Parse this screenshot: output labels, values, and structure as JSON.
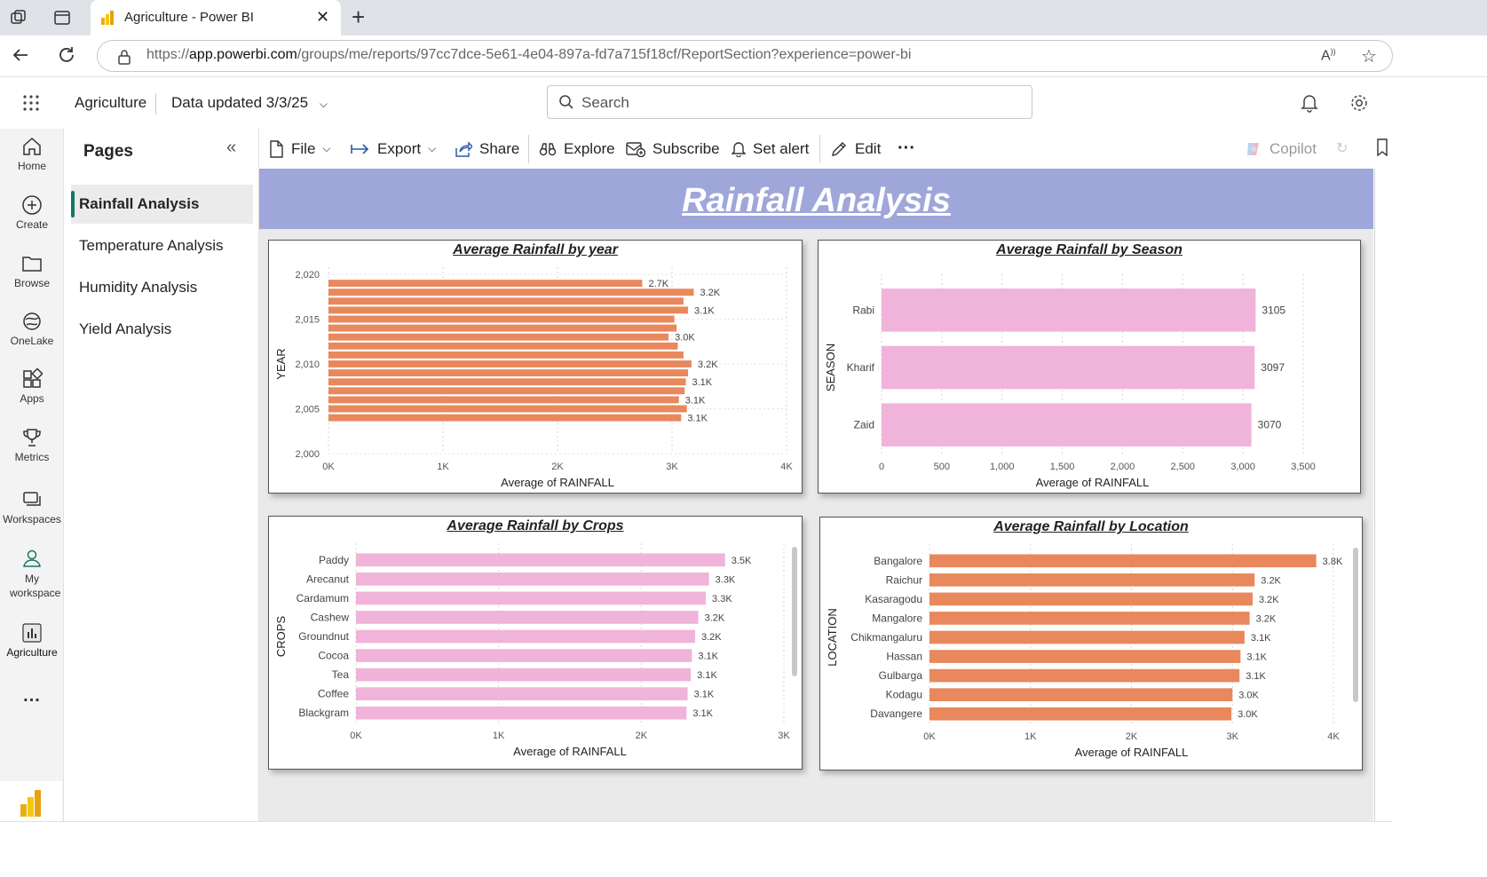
{
  "browser": {
    "tab_title": "Agriculture - Power BI",
    "url_prefix": "https://",
    "url_host": "app.powerbi.com",
    "url_path": "/groups/me/reports/97cc7dce-5e61-4e04-897a-fd7a715f18cf/ReportSection?experience=power-bi"
  },
  "header": {
    "workspace": "Agriculture",
    "data_updated": "Data updated 3/3/25",
    "search_placeholder": "Search"
  },
  "leftnav": {
    "items": [
      {
        "label": "Home",
        "icon": "home-icon"
      },
      {
        "label": "Create",
        "icon": "plus-circle-icon"
      },
      {
        "label": "Browse",
        "icon": "folder-icon"
      },
      {
        "label": "OneLake",
        "icon": "onelake-icon"
      },
      {
        "label": "Apps",
        "icon": "apps-icon"
      },
      {
        "label": "Metrics",
        "icon": "trophy-icon"
      },
      {
        "label": "Workspaces",
        "icon": "workspaces-icon"
      },
      {
        "label": "My workspace",
        "icon": "person-icon"
      },
      {
        "label": "Agriculture",
        "icon": "report-icon"
      }
    ],
    "more": "..."
  },
  "pages_pane": {
    "title": "Pages",
    "items": [
      "Rainfall Analysis",
      "Temperature Analysis",
      "Humidity Analysis",
      "Yield Analysis"
    ],
    "active": "Rainfall Analysis"
  },
  "toolbar": {
    "file": "File",
    "export": "Export",
    "share": "Share",
    "explore": "Explore",
    "subscribe": "Subscribe",
    "set_alert": "Set alert",
    "edit": "Edit",
    "more": "···",
    "copilot": "Copilot"
  },
  "report": {
    "banner_title": "Rainfall Analysis"
  },
  "colors": {
    "orange_bar": "#e8885c",
    "pink_bar": "#f0b3d9",
    "banner": "#9fa6d9",
    "accent": "#117865"
  },
  "chart_data": [
    {
      "id": "by_year",
      "type": "bar",
      "orientation": "horizontal",
      "title": "Average Rainfall by year",
      "xlabel": "Average of RAINFALL",
      "ylabel": "YEAR",
      "xlim": [
        0,
        4000
      ],
      "ylim": [
        2000,
        2020
      ],
      "x_ticks": [
        "0K",
        "1K",
        "2K",
        "3K",
        "4K"
      ],
      "y_ticks": [
        "2,000",
        "2,005",
        "2,010",
        "2,015",
        "2,020"
      ],
      "years": [
        2019,
        2018,
        2017,
        2016,
        2015,
        2014,
        2013,
        2012,
        2011,
        2010,
        2009,
        2008,
        2007,
        2006,
        2005,
        2004
      ],
      "values": [
        2740,
        3190,
        3100,
        3140,
        3020,
        3040,
        2970,
        3050,
        3100,
        3170,
        3140,
        3120,
        3110,
        3060,
        3130,
        3080
      ],
      "labels": [
        "2.7K",
        "3.2K",
        "",
        "3.1K",
        "",
        "",
        "3.0K",
        "",
        "",
        "3.2K",
        "",
        "3.1K",
        "",
        "3.1K",
        "",
        "3.1K"
      ],
      "color": "#e8885c"
    },
    {
      "id": "by_season",
      "type": "bar",
      "orientation": "horizontal",
      "title": "Average Rainfall by Season",
      "xlabel": "Average of RAINFALL",
      "ylabel": "SEASON",
      "xlim": [
        0,
        3500
      ],
      "x_ticks": [
        "0",
        "500",
        "1,000",
        "1,500",
        "2,000",
        "2,500",
        "3,000",
        "3,500"
      ],
      "categories": [
        "Rabi",
        "Kharif",
        "Zaid"
      ],
      "values": [
        3105,
        3097,
        3070
      ],
      "labels": [
        "3105",
        "3097",
        "3070"
      ],
      "color": "#f0b3d9"
    },
    {
      "id": "by_crops",
      "type": "bar",
      "orientation": "horizontal",
      "title": "Average Rainfall by Crops",
      "xlabel": "Average of RAINFALL",
      "ylabel": "CROPS",
      "xlim": [
        0,
        3500
      ],
      "x_ticks": [
        "0K",
        "1K",
        "2K",
        "3K"
      ],
      "categories": [
        "Paddy",
        "Arecanut",
        "Cardamum",
        "Cashew",
        "Groundnut",
        "Cocoa",
        "Tea",
        "Coffee",
        "Blackgram"
      ],
      "values": [
        3450,
        3300,
        3270,
        3200,
        3170,
        3140,
        3130,
        3100,
        3090
      ],
      "labels": [
        "3.5K",
        "3.3K",
        "3.3K",
        "3.2K",
        "3.2K",
        "3.1K",
        "3.1K",
        "3.1K",
        "3.1K"
      ],
      "color": "#f0b3d9"
    },
    {
      "id": "by_location",
      "type": "bar",
      "orientation": "horizontal",
      "title": "Average Rainfall by Location",
      "xlabel": "Average of RAINFALL",
      "ylabel": "LOCATION",
      "xlim": [
        0,
        4000
      ],
      "x_ticks": [
        "0K",
        "1K",
        "2K",
        "3K",
        "4K"
      ],
      "categories": [
        "Bangalore",
        "Raichur",
        "Kasaragodu",
        "Mangalore",
        "Chikmangaluru",
        "Hassan",
        "Gulbarga",
        "Kodagu",
        "Davangere"
      ],
      "values": [
        3830,
        3220,
        3200,
        3170,
        3120,
        3080,
        3070,
        3000,
        2990
      ],
      "labels": [
        "3.8K",
        "3.2K",
        "3.2K",
        "3.2K",
        "3.1K",
        "3.1K",
        "3.1K",
        "3.0K",
        "3.0K"
      ],
      "color": "#e8885c"
    }
  ]
}
